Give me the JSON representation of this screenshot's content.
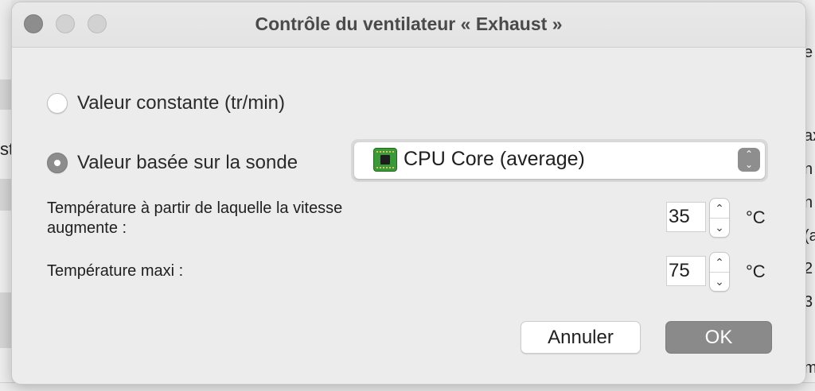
{
  "dialog": {
    "title": "Contrôle du ventilateur « Exhaust »"
  },
  "mode": {
    "constant_label": "Valeur constante (tr/min)",
    "constant_selected": false,
    "sensor_label": "Valeur basée sur la sonde",
    "sensor_selected": true
  },
  "sensor_select": {
    "icon": "cpu-chip-icon",
    "selected_value": "CPU Core (average)"
  },
  "start_temperature": {
    "label": "Température à partir de laquelle la vitesse augmente :",
    "value": "35",
    "unit": "°C"
  },
  "max_temperature": {
    "label": "Température maxi :",
    "value": "75",
    "unit": "°C"
  },
  "buttons": {
    "cancel_label": "Annuler",
    "ok_label": "OK"
  },
  "background": {
    "left_text": "st",
    "right_items": [
      "e",
      "ax",
      "n",
      "n",
      "(a",
      "2",
      "3",
      "m"
    ]
  },
  "colors": {
    "dialog_bg": "#ececec",
    "default_button": "#8a8a8a",
    "chip_green": "#3a9a3a"
  }
}
